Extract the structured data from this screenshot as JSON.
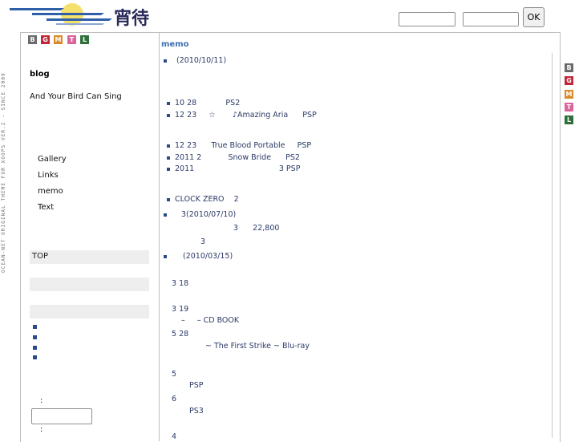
{
  "header": {
    "logo_text": "宵待",
    "ok_label": "OK",
    "search_value": "",
    "search2_value": ""
  },
  "side_vertical_text": "OCEAN-NET ORIGINAL THEME FOR XOOPS VER.2 - SINCE 2009",
  "tags": [
    "B",
    "G",
    "M",
    "T",
    "L"
  ],
  "sidebar": {
    "blog_heading": "blog",
    "blog_title": "And Your Bird Can Sing",
    "nav": [
      "Gallery",
      "Links",
      "memo",
      "Text"
    ],
    "top_label": "TOP",
    "colon1": ":",
    "colon2": ":",
    "input_value": ""
  },
  "main": {
    "section_title": "memo",
    "lines": [
      {
        "text": "(2010/10/11)"
      },
      {
        "text": "10 28            PS2"
      },
      {
        "text": "12 23     ☆       ♪Amazing Aria      PSP"
      },
      {
        "text": "12 23      True Blood Portable     PSP"
      },
      {
        "text": "2011 2           Snow Bride      PS2"
      },
      {
        "text": "2011                                   3 PSP"
      },
      {
        "text": "CLOCK ZERO    2"
      },
      {
        "text": "3(2010/07/10)"
      },
      {
        "text": "3      22,800"
      },
      {
        "text": "3"
      },
      {
        "text": "(2010/03/15)"
      },
      {
        "text": "3 18"
      },
      {
        "text": "3 19"
      },
      {
        "text": "–     – CD BOOK"
      },
      {
        "text": "5 28"
      },
      {
        "text": "~ The First Strike ~ Blu-ray"
      },
      {
        "text": "5"
      },
      {
        "text": "PSP"
      },
      {
        "text": "6"
      },
      {
        "text": "PS3"
      },
      {
        "text": "4"
      }
    ]
  },
  "colors": {
    "accent": "#3d6fb2",
    "text": "#2b3a67",
    "tag_b": "#6b6b6b",
    "tag_g": "#c0283a",
    "tag_m": "#d98b2b",
    "tag_t": "#d9669a",
    "tag_l": "#2f6f3a"
  }
}
